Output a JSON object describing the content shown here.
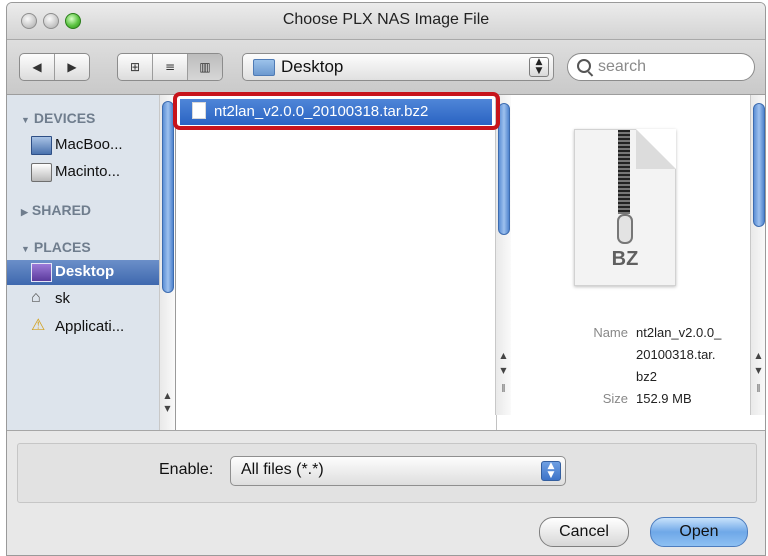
{
  "window": {
    "title": "Choose PLX NAS Image File"
  },
  "toolbar": {
    "back_glyph": "◀",
    "forward_glyph": "▶",
    "view_icon_glyph": "⊞",
    "view_list_glyph": "≡",
    "view_column_glyph": "▥",
    "location": "Desktop",
    "search_placeholder": "search"
  },
  "sidebar": {
    "devices_header": "DEVICES",
    "shared_header": "SHARED",
    "places_header": "PLACES",
    "devices": [
      {
        "label": "MacBoo...",
        "icon": "laptop-icon"
      },
      {
        "label": "Macinto...",
        "icon": "hard-drive-icon"
      }
    ],
    "places": [
      {
        "label": "Desktop",
        "icon": "desktop-icon",
        "selected": true
      },
      {
        "label": "sk",
        "icon": "home-icon"
      },
      {
        "label": "Applicati...",
        "icon": "applications-icon"
      }
    ]
  },
  "browser": {
    "files": [
      {
        "name": "nt2lan_v2.0.0_20100318.tar.bz2",
        "selected": true
      }
    ]
  },
  "preview": {
    "extension": "BZ",
    "name_key": "Name",
    "name_value_lines": [
      "nt2lan_v2.0.0_",
      "20100318.tar.",
      "bz2"
    ],
    "size_key": "Size",
    "size_value": "152.9 MB"
  },
  "bottom": {
    "enable_label": "Enable:",
    "enable_value": "All files (*.*)",
    "cancel_label": "Cancel",
    "open_label": "Open"
  },
  "colors": {
    "selection": "#3e68ae",
    "highlight_box": "#c7141b",
    "open_button": "#6fa8e8"
  }
}
